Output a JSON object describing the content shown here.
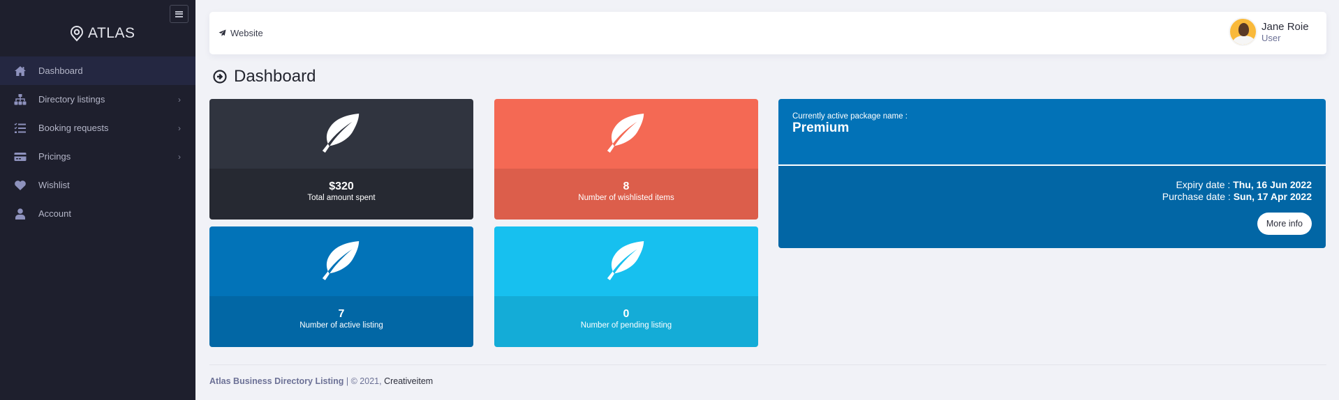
{
  "sidebar": {
    "logo_text": "ATLAS",
    "toggle_icon": "hamburger-icon",
    "items": [
      {
        "label": "Dashboard",
        "icon": "home-icon",
        "active": true,
        "has_submenu": false
      },
      {
        "label": "Directory listings",
        "icon": "sitemap-icon",
        "active": false,
        "has_submenu": true
      },
      {
        "label": "Booking requests",
        "icon": "tasks-list-icon",
        "active": false,
        "has_submenu": true
      },
      {
        "label": "Pricings",
        "icon": "credit-card-icon",
        "active": false,
        "has_submenu": true
      },
      {
        "label": "Wishlist",
        "icon": "heart-icon",
        "active": false,
        "has_submenu": false
      },
      {
        "label": "Account",
        "icon": "user-icon",
        "active": false,
        "has_submenu": false
      }
    ],
    "chevron": "›"
  },
  "header": {
    "website_label": "Website",
    "user": {
      "name": "Jane Roie",
      "role": "User"
    }
  },
  "page": {
    "title": "Dashboard"
  },
  "stats": [
    {
      "value": "$320",
      "caption": "Total amount spent",
      "color": "#30343f"
    },
    {
      "value": "8",
      "caption": "Number of wishlisted items",
      "color": "#f46954"
    },
    {
      "value": "7",
      "caption": "Number of active listing",
      "color": "#0273b8"
    },
    {
      "value": "0",
      "caption": "Number of pending listing",
      "color": "#17c0ef"
    }
  ],
  "package": {
    "label": "Currently active package name :",
    "name": "Premium",
    "expiry_label": "Expiry date : ",
    "expiry_value": "Thu, 16 Jun 2022",
    "purchase_label": "Purchase date : ",
    "purchase_value": "Sun, 17 Apr 2022",
    "more_info_label": "More info"
  },
  "footer": {
    "brand": "Atlas Business Directory Listing",
    "separator": " | © 2021, ",
    "company": "Creativeitem"
  }
}
